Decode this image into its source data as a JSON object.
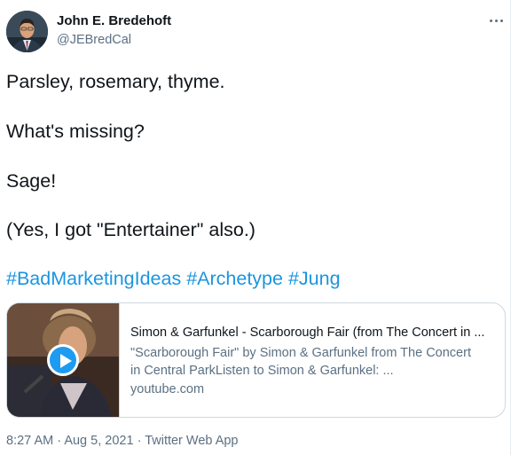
{
  "author": {
    "name": "John E. Bredehoft",
    "handle": "@JEBredCal"
  },
  "tweet": {
    "paragraphs": [
      "Parsley, rosemary, thyme.",
      "What's missing?",
      "Sage!",
      "(Yes, I got \"Entertainer\" also.)"
    ],
    "hashtags": [
      "#BadMarketingIdeas",
      "#Archetype",
      "#Jung"
    ]
  },
  "card": {
    "title": "Simon & Garfunkel - Scarborough Fair (from The Concert in ...",
    "description_line1": "\"Scarborough Fair\" by Simon & Garfunkel from The Concert",
    "description_line2": "in Central ParkListen to Simon & Garfunkel: ...",
    "domain": "youtube.com"
  },
  "meta": {
    "time": "8:27 AM",
    "date": "Aug 5, 2021",
    "source": "Twitter Web App",
    "separator": "·"
  },
  "icons": {
    "more": "more-horizontal-icon",
    "play": "play-icon"
  },
  "colors": {
    "link": "#1b95e0",
    "secondary_text": "#5b7083",
    "play_button": "#1d9bf0"
  }
}
